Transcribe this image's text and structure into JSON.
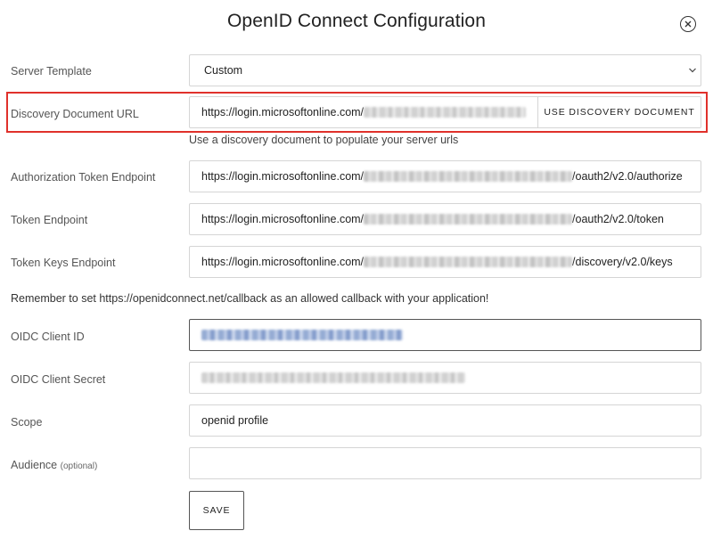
{
  "dialog": {
    "title": "OpenID Connect Configuration"
  },
  "server_template": {
    "label": "Server Template",
    "value": "Custom"
  },
  "discovery": {
    "label": "Discovery Document URL",
    "value_prefix": "https://login.microsoftonline.com/",
    "button_label": "USE DISCOVERY DOCUMENT",
    "hint": "Use a discovery document to populate your server urls"
  },
  "auth_endpoint": {
    "label": "Authorization Token Endpoint",
    "value_prefix": "https://login.microsoftonline.com/",
    "value_suffix": "/oauth2/v2.0/authorize"
  },
  "token_endpoint": {
    "label": "Token Endpoint",
    "value_prefix": "https://login.microsoftonline.com/",
    "value_suffix": "/oauth2/v2.0/token"
  },
  "keys_endpoint": {
    "label": "Token Keys Endpoint",
    "value_prefix": "https://login.microsoftonline.com/",
    "value_suffix": "/discovery/v2.0/keys"
  },
  "callback_note": "Remember to set https://openidconnect.net/callback as an allowed callback with your application!",
  "client_id": {
    "label": "OIDC Client ID"
  },
  "client_secret": {
    "label": "OIDC Client Secret"
  },
  "scope": {
    "label": "Scope",
    "value": "openid profile"
  },
  "audience": {
    "label": "Audience",
    "optional": "(optional)",
    "value": ""
  },
  "save_label": "SAVE",
  "colors": {
    "highlight": "#e0312b",
    "border": "#d5d5d5",
    "text": "#222222"
  }
}
